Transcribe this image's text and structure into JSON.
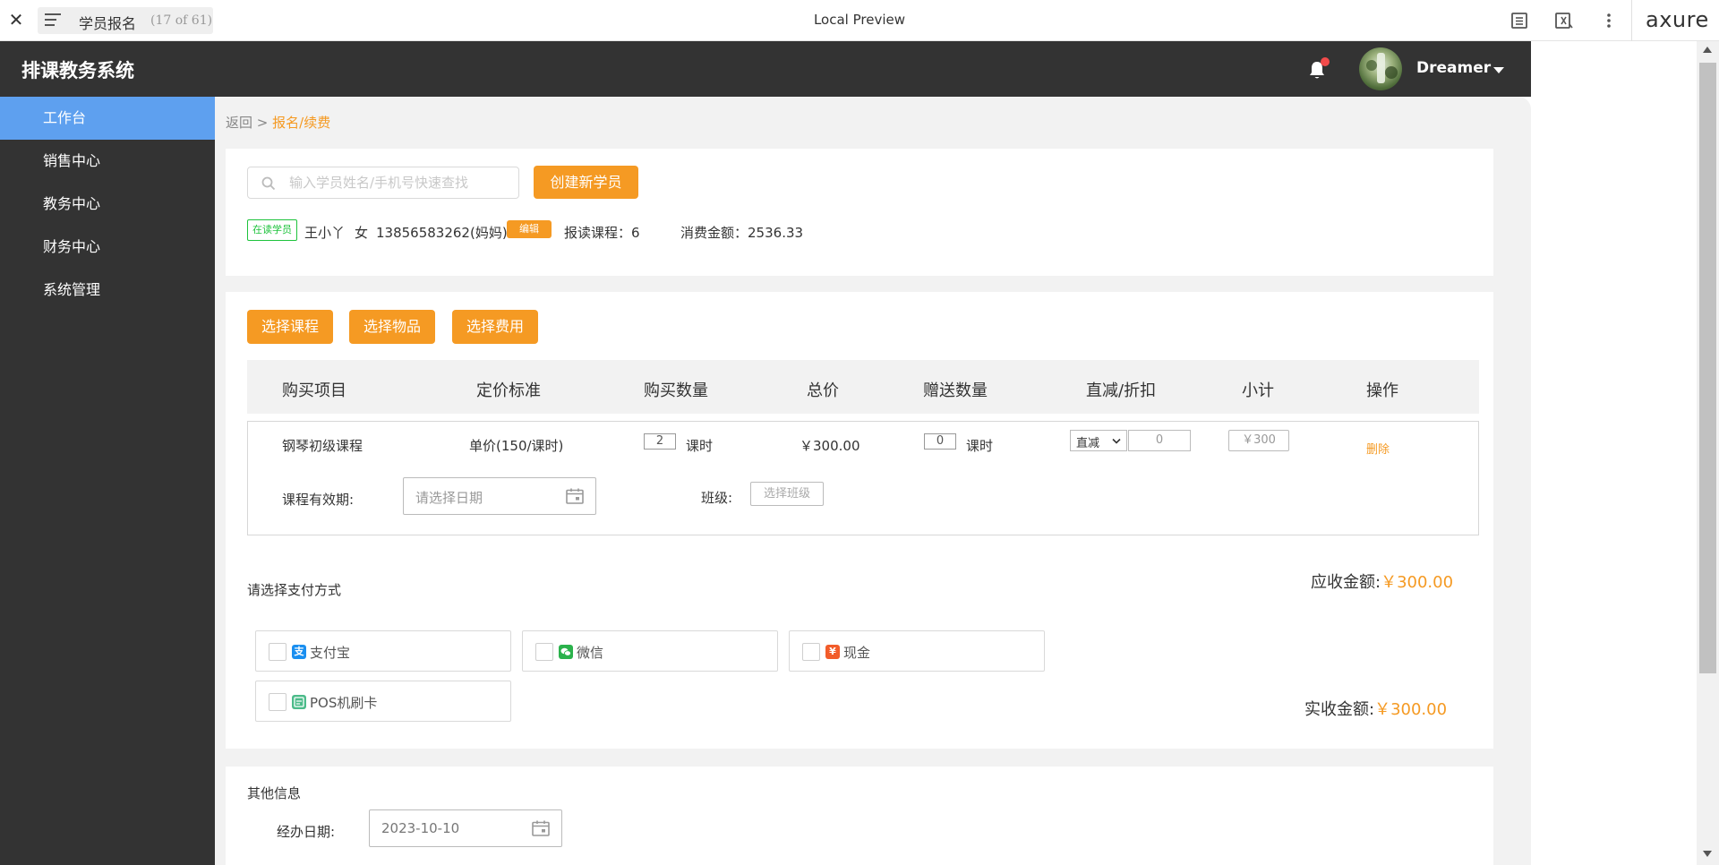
{
  "topbar": {
    "page_title": "学员报名",
    "page_count": "(17 of 61)",
    "center_title": "Local Preview",
    "logo": "axure"
  },
  "app": {
    "title": "排课教务系统",
    "user_name": "Dreamer"
  },
  "sidebar": {
    "items": [
      {
        "label": "工作台",
        "active": true
      },
      {
        "label": "销售中心"
      },
      {
        "label": "教务中心"
      },
      {
        "label": "财务中心"
      },
      {
        "label": "系统管理"
      }
    ]
  },
  "breadcrumb": {
    "back": "返回",
    "separator": ">",
    "current": "报名/续费"
  },
  "search": {
    "placeholder": "输入学员姓名/手机号快速查找",
    "create_button": "创建新学员"
  },
  "student": {
    "status_tag": "在读学员",
    "name": "王小丫",
    "gender": "女",
    "phone": "13856583262(妈妈)",
    "edit_button": "编辑",
    "courses_label": "报读课程：",
    "courses_value": "6",
    "spend_label": "消费金额：",
    "spend_value": "2536.33"
  },
  "actions": {
    "select_course": "选择课程",
    "select_item": "选择物品",
    "select_fee": "选择费用"
  },
  "table": {
    "headers": [
      "购买项目",
      "定价标准",
      "购买数量",
      "总价",
      "赠送数量",
      "直减/折扣",
      "小计",
      "操作"
    ],
    "row": {
      "item": "钢琴初级课程",
      "price_std": "单价(150/课时)",
      "qty": "2",
      "qty_unit": "课时",
      "total": "￥300.00",
      "gift_qty": "0",
      "gift_unit": "课时",
      "discount_type": "直减",
      "discount_value": "0",
      "subtotal": "￥300",
      "delete": "删除"
    },
    "validity_label": "课程有效期:",
    "validity_placeholder": "请选择日期",
    "class_label": "班级:",
    "class_button": "选择班级"
  },
  "payment": {
    "title": "请选择支付方式",
    "receivable_label": "应收金额:",
    "receivable_value": "￥300.00",
    "received_label": "实收金额:",
    "received_value": "￥300.00",
    "options": [
      {
        "label": "支付宝",
        "icon": "alipay-icon",
        "color": "#1a8ff0"
      },
      {
        "label": "微信",
        "icon": "wechat-icon",
        "color": "#2bb24c"
      },
      {
        "label": "现金",
        "icon": "cash-icon",
        "color": "#f25c2a"
      },
      {
        "label": "POS机刷卡",
        "icon": "pos-card-icon",
        "color": "#4cbb8a"
      }
    ]
  },
  "other": {
    "title": "其他信息",
    "date_label": "经办日期:",
    "date_value": "2023-10-10"
  },
  "colors": {
    "accent": "#f59a23",
    "sidebar_bg": "#333333",
    "active_item": "#5ea0ef",
    "status_green": "#1ec33c"
  }
}
